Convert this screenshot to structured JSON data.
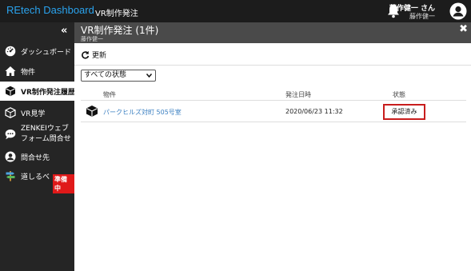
{
  "header": {
    "brand": "REtech Dashboard",
    "title": "VR制作発注",
    "user_name": "藤作健一 さん",
    "user_sub": "藤作健一"
  },
  "sidebar": {
    "collapse_glyph": "«",
    "items": [
      {
        "label": "ダッシュボード",
        "icon": "dashboard-gauge-icon"
      },
      {
        "label": "物件",
        "icon": "home-icon"
      },
      {
        "label": "VR制作発注履歴",
        "icon": "cube-icon",
        "active": true
      },
      {
        "label": "VR見学",
        "icon": "vr-view-icon"
      },
      {
        "label": "ZENKEIウェブフォーム問合せ",
        "icon": "chat-icon"
      },
      {
        "label": "問合せ先",
        "icon": "contact-user-icon"
      },
      {
        "label": "道しるべ",
        "icon": "signpost-icon"
      }
    ],
    "badge": "準備中"
  },
  "panel": {
    "title": "VR制作発注 (1件)",
    "subtitle": "藤作健一",
    "close_glyph": "✖"
  },
  "toolbar": {
    "refresh_label": "更新"
  },
  "filter": {
    "selected": "すべての状態"
  },
  "table": {
    "columns": [
      "物件",
      "発注日時",
      "状態"
    ],
    "rows": [
      {
        "name": "パークヒルズ対町 505号室",
        "date": "2020/06/23 11:32",
        "status": "承認済み"
      }
    ]
  },
  "colors": {
    "topbar": "#1c1c1c",
    "brand": "#2aa3ee",
    "sidebar": "#252525",
    "panel_header": "#4a4a4a",
    "link": "#3a7fc1",
    "highlight": "#c81d1d"
  }
}
